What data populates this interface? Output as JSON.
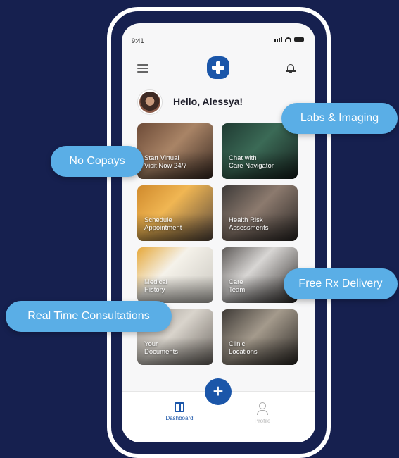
{
  "status": {
    "time": "9:41"
  },
  "header": {
    "greeting": "Hello, Alessya!"
  },
  "tiles": [
    {
      "label": "Start Virtual\nVisit Now 24/7"
    },
    {
      "label": "Chat with\nCare Navigator"
    },
    {
      "label": "Schedule\nAppointment"
    },
    {
      "label": "Health Risk\nAssessments"
    },
    {
      "label": "Medical\nHistory"
    },
    {
      "label": "Care\nTeam"
    },
    {
      "label": "Your\nDocuments"
    },
    {
      "label": "Clinic\nLocations"
    }
  ],
  "nav": {
    "dashboard": "Dashboard",
    "profile": "Profile",
    "fab": "+"
  },
  "callouts": {
    "labs": "Labs & Imaging",
    "copays": "No Copays",
    "rx": "Free Rx Delivery",
    "consult": "Real Time Consultations"
  },
  "colors": {
    "background": "#16204f",
    "brand": "#1b56a9",
    "callout": "#5aaee6"
  }
}
